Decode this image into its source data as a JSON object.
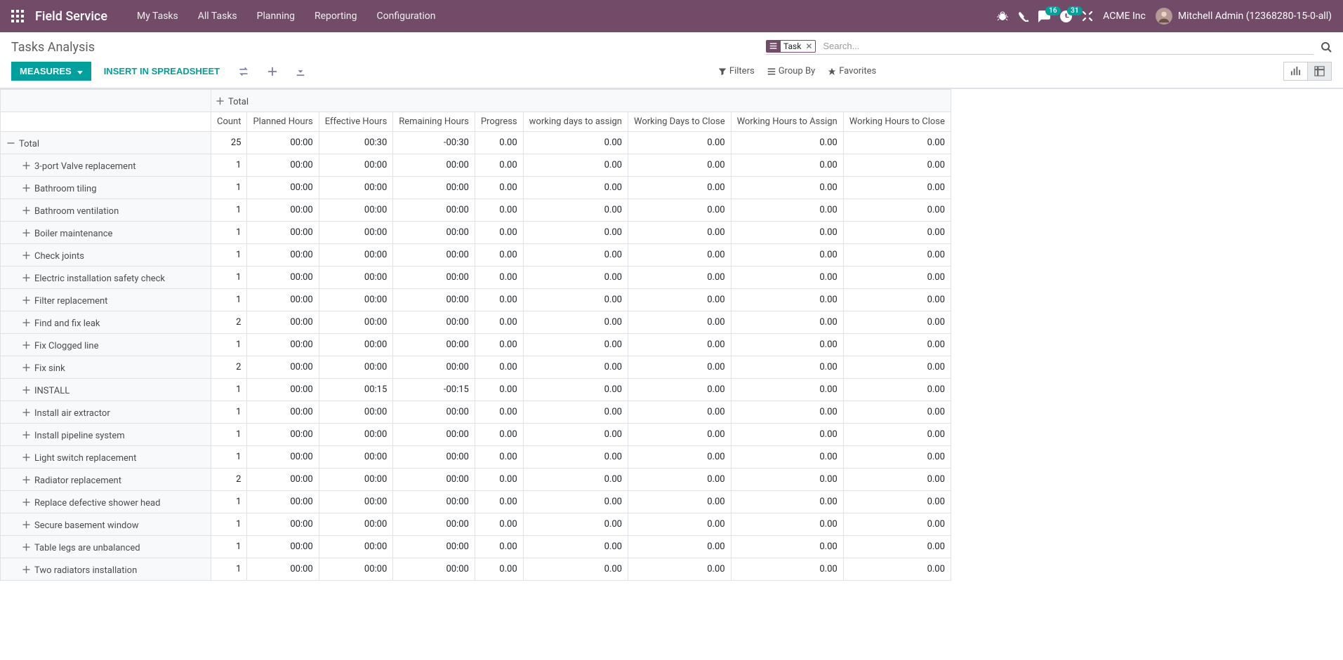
{
  "header": {
    "app_name": "Field Service",
    "menu": [
      "My Tasks",
      "All Tasks",
      "Planning",
      "Reporting",
      "Configuration"
    ],
    "msg_badge": "16",
    "activity_badge": "31",
    "company": "ACME Inc",
    "user": "Mitchell Admin (12368280-15-0-all)"
  },
  "page": {
    "title": "Tasks Analysis",
    "search_facet": "Task",
    "search_placeholder": "Search...",
    "measures_btn": "MEASURES",
    "spreadsheet_btn": "INSERT IN SPREADSHEET",
    "filters": "Filters",
    "groupby": "Group By",
    "favorites": "Favorites"
  },
  "pivot": {
    "total_label": "Total",
    "columns": [
      "Count",
      "Planned Hours",
      "Effective Hours",
      "Remaining Hours",
      "Progress",
      "working days to assign",
      "Working Days to Close",
      "Working Hours to Assign",
      "Working Hours to Close"
    ],
    "total_row": {
      "label": "Total",
      "values": [
        "25",
        "00:00",
        "00:30",
        "-00:30",
        "0.00",
        "0.00",
        "0.00",
        "0.00",
        "0.00"
      ]
    },
    "rows": [
      {
        "label": "3-port Valve replacement",
        "values": [
          "1",
          "00:00",
          "00:00",
          "00:00",
          "0.00",
          "0.00",
          "0.00",
          "0.00",
          "0.00"
        ]
      },
      {
        "label": "Bathroom tiling",
        "values": [
          "1",
          "00:00",
          "00:00",
          "00:00",
          "0.00",
          "0.00",
          "0.00",
          "0.00",
          "0.00"
        ]
      },
      {
        "label": "Bathroom ventilation",
        "values": [
          "1",
          "00:00",
          "00:00",
          "00:00",
          "0.00",
          "0.00",
          "0.00",
          "0.00",
          "0.00"
        ]
      },
      {
        "label": "Boiler maintenance",
        "values": [
          "1",
          "00:00",
          "00:00",
          "00:00",
          "0.00",
          "0.00",
          "0.00",
          "0.00",
          "0.00"
        ]
      },
      {
        "label": "Check joints",
        "values": [
          "1",
          "00:00",
          "00:00",
          "00:00",
          "0.00",
          "0.00",
          "0.00",
          "0.00",
          "0.00"
        ]
      },
      {
        "label": "Electric installation safety check",
        "values": [
          "1",
          "00:00",
          "00:00",
          "00:00",
          "0.00",
          "0.00",
          "0.00",
          "0.00",
          "0.00"
        ]
      },
      {
        "label": "Filter replacement",
        "values": [
          "1",
          "00:00",
          "00:00",
          "00:00",
          "0.00",
          "0.00",
          "0.00",
          "0.00",
          "0.00"
        ]
      },
      {
        "label": "Find and fix leak",
        "values": [
          "2",
          "00:00",
          "00:00",
          "00:00",
          "0.00",
          "0.00",
          "0.00",
          "0.00",
          "0.00"
        ]
      },
      {
        "label": "Fix Clogged line",
        "values": [
          "1",
          "00:00",
          "00:00",
          "00:00",
          "0.00",
          "0.00",
          "0.00",
          "0.00",
          "0.00"
        ]
      },
      {
        "label": "Fix sink",
        "values": [
          "2",
          "00:00",
          "00:00",
          "00:00",
          "0.00",
          "0.00",
          "0.00",
          "0.00",
          "0.00"
        ]
      },
      {
        "label": "INSTALL",
        "values": [
          "1",
          "00:00",
          "00:15",
          "-00:15",
          "0.00",
          "0.00",
          "0.00",
          "0.00",
          "0.00"
        ]
      },
      {
        "label": "Install air extractor",
        "values": [
          "1",
          "00:00",
          "00:00",
          "00:00",
          "0.00",
          "0.00",
          "0.00",
          "0.00",
          "0.00"
        ]
      },
      {
        "label": "Install pipeline system",
        "values": [
          "1",
          "00:00",
          "00:00",
          "00:00",
          "0.00",
          "0.00",
          "0.00",
          "0.00",
          "0.00"
        ]
      },
      {
        "label": "Light switch replacement",
        "values": [
          "1",
          "00:00",
          "00:00",
          "00:00",
          "0.00",
          "0.00",
          "0.00",
          "0.00",
          "0.00"
        ]
      },
      {
        "label": "Radiator replacement",
        "values": [
          "2",
          "00:00",
          "00:00",
          "00:00",
          "0.00",
          "0.00",
          "0.00",
          "0.00",
          "0.00"
        ]
      },
      {
        "label": "Replace defective shower head",
        "values": [
          "1",
          "00:00",
          "00:00",
          "00:00",
          "0.00",
          "0.00",
          "0.00",
          "0.00",
          "0.00"
        ]
      },
      {
        "label": "Secure basement window",
        "values": [
          "1",
          "00:00",
          "00:00",
          "00:00",
          "0.00",
          "0.00",
          "0.00",
          "0.00",
          "0.00"
        ]
      },
      {
        "label": "Table legs are unbalanced",
        "values": [
          "1",
          "00:00",
          "00:00",
          "00:00",
          "0.00",
          "0.00",
          "0.00",
          "0.00",
          "0.00"
        ]
      },
      {
        "label": "Two radiators installation",
        "values": [
          "1",
          "00:00",
          "00:00",
          "00:00",
          "0.00",
          "0.00",
          "0.00",
          "0.00",
          "0.00"
        ]
      }
    ]
  }
}
